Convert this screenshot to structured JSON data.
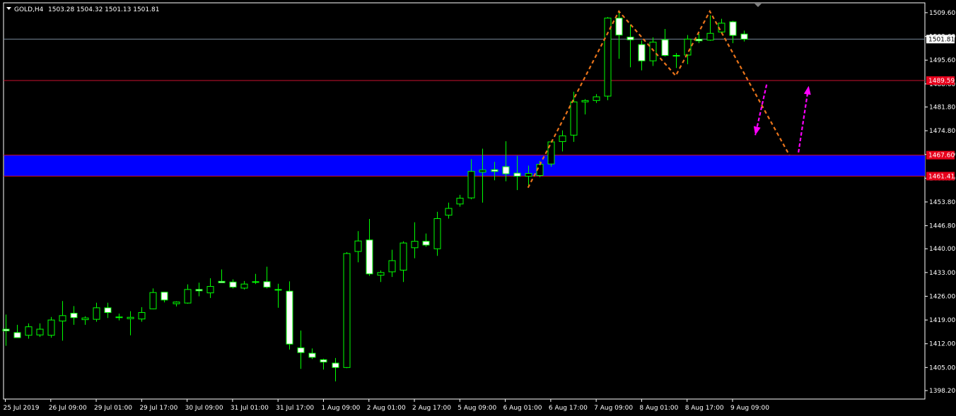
{
  "header": {
    "symbol": "GOLD,H4",
    "ohlc": "1503.28 1504.32 1501.13 1501.81"
  },
  "colors": {
    "background": "#000000",
    "frame": "#ffffff",
    "bull_body": "#000000",
    "bear_body": "#ffffff",
    "wick": "#00ff00",
    "zone": "#0000ff",
    "resistance_line": "#c8102e",
    "price_line": "#778899",
    "pattern_line": "#e8731a",
    "arrow": "#ff00ff",
    "price_label_bg": "#ffffff",
    "level_label_bg": "#e8001c"
  },
  "chart_data": {
    "type": "candlestick",
    "title": "",
    "ylim": [
      1395.7,
      1512.5
    ],
    "y_ticks": [
      "1509.60",
      "1502.60",
      "1495.60",
      "1488.60",
      "1481.80",
      "1474.80",
      "1467.80",
      "1460.80",
      "1453.80",
      "1446.80",
      "1440.00",
      "1433.00",
      "1426.00",
      "1419.00",
      "1412.00",
      "1405.00",
      "1398.20"
    ],
    "x_ticks": [
      "25 Jul 2019",
      "26 Jul 09:00",
      "29 Jul 01:00",
      "29 Jul 17:00",
      "30 Jul 09:00",
      "31 Jul 01:00",
      "31 Jul 17:00",
      "1 Aug 09:00",
      "2 Aug 01:00",
      "2 Aug 17:00",
      "5 Aug 09:00",
      "6 Aug 01:00",
      "6 Aug 17:00",
      "7 Aug 09:00",
      "8 Aug 01:00",
      "8 Aug 17:00",
      "9 Aug 09:00"
    ],
    "candles": [
      {
        "o": 1416.3,
        "h": 1420.6,
        "l": 1411.4,
        "c": 1415.8
      },
      {
        "o": 1415.3,
        "h": 1417.6,
        "l": 1413.8,
        "c": 1413.8
      },
      {
        "o": 1414.5,
        "h": 1418.0,
        "l": 1413.5,
        "c": 1417.0
      },
      {
        "o": 1414.6,
        "h": 1418.0,
        "l": 1414.0,
        "c": 1416.3
      },
      {
        "o": 1414.5,
        "h": 1419.9,
        "l": 1413.8,
        "c": 1419.0
      },
      {
        "o": 1418.7,
        "h": 1424.6,
        "l": 1412.9,
        "c": 1420.3
      },
      {
        "o": 1421.0,
        "h": 1423.1,
        "l": 1417.6,
        "c": 1419.7
      },
      {
        "o": 1419.1,
        "h": 1420.1,
        "l": 1417.6,
        "c": 1419.6
      },
      {
        "o": 1419.2,
        "h": 1424.1,
        "l": 1418.5,
        "c": 1422.6
      },
      {
        "o": 1422.6,
        "h": 1424.1,
        "l": 1419.6,
        "c": 1421.2
      },
      {
        "o": 1419.9,
        "h": 1420.9,
        "l": 1418.9,
        "c": 1419.7
      },
      {
        "o": 1419.4,
        "h": 1421.6,
        "l": 1414.5,
        "c": 1419.8
      },
      {
        "o": 1419.3,
        "h": 1422.8,
        "l": 1418.5,
        "c": 1421.2
      },
      {
        "o": 1422.3,
        "h": 1428.3,
        "l": 1422.2,
        "c": 1427.1
      },
      {
        "o": 1427.2,
        "h": 1427.2,
        "l": 1424.2,
        "c": 1424.9
      },
      {
        "o": 1423.8,
        "h": 1424.5,
        "l": 1423.0,
        "c": 1424.3
      },
      {
        "o": 1424.0,
        "h": 1429.5,
        "l": 1423.8,
        "c": 1428.0
      },
      {
        "o": 1428.0,
        "h": 1430.0,
        "l": 1426.0,
        "c": 1427.6
      },
      {
        "o": 1427.0,
        "h": 1431.3,
        "l": 1425.5,
        "c": 1428.9
      },
      {
        "o": 1430.4,
        "h": 1433.9,
        "l": 1430.0,
        "c": 1430.0
      },
      {
        "o": 1430.2,
        "h": 1431.0,
        "l": 1428.3,
        "c": 1428.7
      },
      {
        "o": 1428.4,
        "h": 1430.5,
        "l": 1428.0,
        "c": 1429.6
      },
      {
        "o": 1430.3,
        "h": 1432.6,
        "l": 1429.6,
        "c": 1430.3
      },
      {
        "o": 1430.3,
        "h": 1434.7,
        "l": 1428.3,
        "c": 1428.7
      },
      {
        "o": 1428.0,
        "h": 1429.7,
        "l": 1422.6,
        "c": 1427.9
      },
      {
        "o": 1427.5,
        "h": 1430.4,
        "l": 1410.3,
        "c": 1411.9
      },
      {
        "o": 1410.8,
        "h": 1415.9,
        "l": 1404.6,
        "c": 1409.4
      },
      {
        "o": 1409.2,
        "h": 1410.6,
        "l": 1407.5,
        "c": 1408.0
      },
      {
        "o": 1407.3,
        "h": 1407.6,
        "l": 1404.4,
        "c": 1406.6
      },
      {
        "o": 1406.3,
        "h": 1407.8,
        "l": 1400.9,
        "c": 1405.0
      },
      {
        "o": 1405.0,
        "h": 1439.0,
        "l": 1404.8,
        "c": 1438.6
      },
      {
        "o": 1439.2,
        "h": 1445.2,
        "l": 1436.0,
        "c": 1442.3
      },
      {
        "o": 1442.6,
        "h": 1448.8,
        "l": 1432.0,
        "c": 1432.6
      },
      {
        "o": 1432.2,
        "h": 1433.6,
        "l": 1430.2,
        "c": 1433.0
      },
      {
        "o": 1433.2,
        "h": 1439.7,
        "l": 1431.7,
        "c": 1436.5
      },
      {
        "o": 1433.7,
        "h": 1442.2,
        "l": 1430.2,
        "c": 1441.7
      },
      {
        "o": 1440.3,
        "h": 1447.8,
        "l": 1437.2,
        "c": 1442.2
      },
      {
        "o": 1442.2,
        "h": 1444.5,
        "l": 1440.6,
        "c": 1441.1
      },
      {
        "o": 1440.0,
        "h": 1450.9,
        "l": 1437.9,
        "c": 1448.9
      },
      {
        "o": 1449.9,
        "h": 1453.6,
        "l": 1448.9,
        "c": 1451.9
      },
      {
        "o": 1453.2,
        "h": 1455.9,
        "l": 1452.4,
        "c": 1454.9
      },
      {
        "o": 1455.0,
        "h": 1466.4,
        "l": 1454.6,
        "c": 1462.8
      },
      {
        "o": 1462.6,
        "h": 1469.5,
        "l": 1453.6,
        "c": 1463.2
      },
      {
        "o": 1463.3,
        "h": 1465.6,
        "l": 1460.2,
        "c": 1462.8
      },
      {
        "o": 1464.2,
        "h": 1471.7,
        "l": 1459.9,
        "c": 1462.1
      },
      {
        "o": 1462.3,
        "h": 1467.4,
        "l": 1457.3,
        "c": 1461.4
      },
      {
        "o": 1461.4,
        "h": 1464.5,
        "l": 1458.6,
        "c": 1462.2
      },
      {
        "o": 1461.6,
        "h": 1465.9,
        "l": 1461.1,
        "c": 1464.9
      },
      {
        "o": 1465.0,
        "h": 1471.8,
        "l": 1464.2,
        "c": 1471.5
      },
      {
        "o": 1471.6,
        "h": 1474.9,
        "l": 1468.7,
        "c": 1473.3
      },
      {
        "o": 1473.5,
        "h": 1486.3,
        "l": 1471.5,
        "c": 1483.3
      },
      {
        "o": 1483.3,
        "h": 1484.1,
        "l": 1479.6,
        "c": 1483.7
      },
      {
        "o": 1483.7,
        "h": 1485.6,
        "l": 1483.0,
        "c": 1484.8
      },
      {
        "o": 1485.0,
        "h": 1508.3,
        "l": 1483.8,
        "c": 1508.0
      },
      {
        "o": 1508.0,
        "h": 1510.3,
        "l": 1496.0,
        "c": 1503.0
      },
      {
        "o": 1502.4,
        "h": 1506.1,
        "l": 1493.5,
        "c": 1501.6
      },
      {
        "o": 1500.2,
        "h": 1501.4,
        "l": 1492.6,
        "c": 1495.4
      },
      {
        "o": 1495.4,
        "h": 1502.3,
        "l": 1493.9,
        "c": 1500.9
      },
      {
        "o": 1501.6,
        "h": 1504.8,
        "l": 1496.7,
        "c": 1497.0
      },
      {
        "o": 1497.0,
        "h": 1497.7,
        "l": 1493.3,
        "c": 1496.9
      },
      {
        "o": 1497.1,
        "h": 1503.0,
        "l": 1494.4,
        "c": 1501.8
      },
      {
        "o": 1501.8,
        "h": 1503.4,
        "l": 1500.6,
        "c": 1501.3
      },
      {
        "o": 1501.5,
        "h": 1508.8,
        "l": 1501.3,
        "c": 1503.5
      },
      {
        "o": 1503.9,
        "h": 1507.8,
        "l": 1503.7,
        "c": 1506.5
      },
      {
        "o": 1506.9,
        "h": 1507.2,
        "l": 1500.6,
        "c": 1502.9
      },
      {
        "o": 1503.3,
        "h": 1504.3,
        "l": 1501.1,
        "c": 1501.8
      }
    ],
    "current_price": {
      "value": 1501.81,
      "label": "1501.81"
    },
    "levels": [
      {
        "value": 1489.59,
        "label": "1489.59"
      },
      {
        "value": 1467.6,
        "label": "1467.60"
      },
      {
        "value": 1461.41,
        "label": "1461.41"
      }
    ],
    "zone": {
      "from": 1461.41,
      "to": 1467.6
    },
    "pattern_points": [
      [
        46,
        1458.0
      ],
      [
        54,
        1510.0
      ],
      [
        59,
        1491.0
      ],
      [
        62,
        1510.0
      ],
      [
        69,
        1467.6
      ]
    ],
    "arrows": [
      {
        "from": [
          67,
          1488.4
        ],
        "to": [
          66,
          1473.5
        ]
      },
      {
        "from": [
          69.8,
          1468.4
        ],
        "to": [
          70.7,
          1488.0
        ]
      }
    ]
  }
}
